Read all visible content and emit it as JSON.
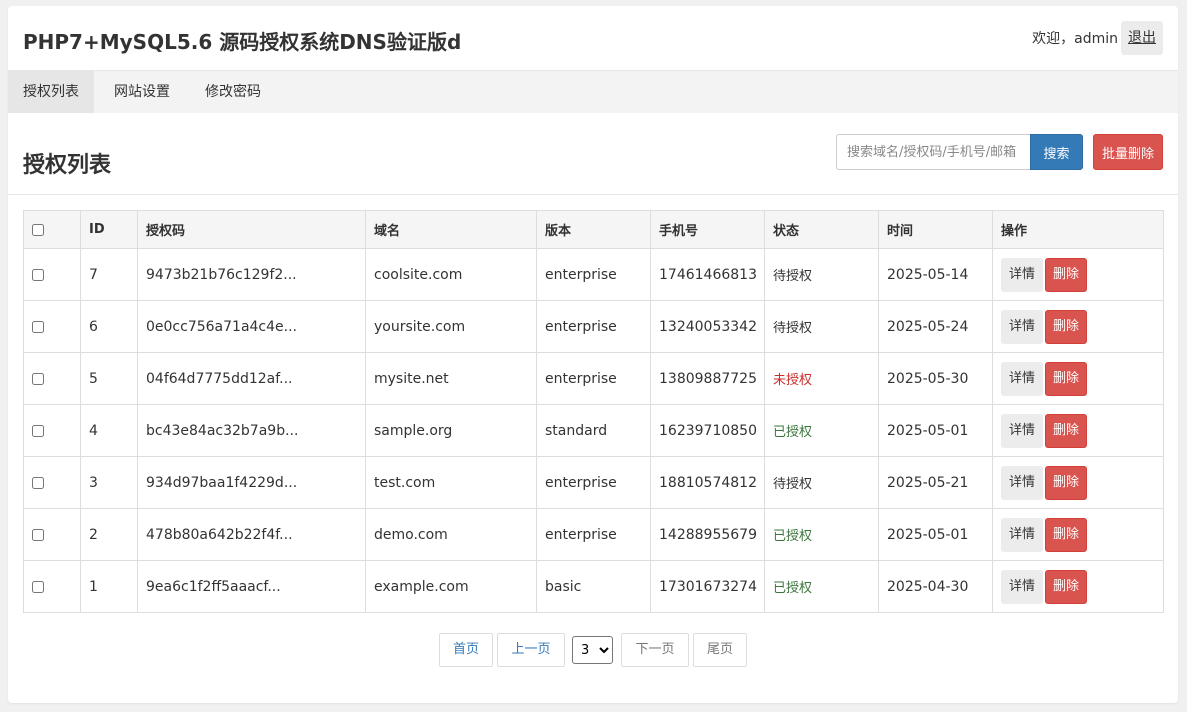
{
  "header": {
    "title": "PHP7+MySQL5.6 源码授权系统DNS验证版d",
    "welcome": "欢迎，admin",
    "logout_label": "退出"
  },
  "nav": {
    "tabs": [
      {
        "label": "授权列表",
        "active": true
      },
      {
        "label": "网站设置",
        "active": false
      },
      {
        "label": "修改密码",
        "active": false
      }
    ]
  },
  "panel": {
    "title": "授权列表",
    "search_placeholder": "搜索域名/授权码/手机号/邮箱",
    "search_label": "搜索",
    "bulk_delete_label": "批量删除"
  },
  "table": {
    "columns": [
      "ID",
      "授权码",
      "域名",
      "版本",
      "手机号",
      "状态",
      "时间",
      "操作"
    ],
    "rows": [
      {
        "id": "7",
        "code": "9473b21b76c129f2...",
        "domain": "coolsite.com",
        "version": "enterprise",
        "phone": "17461466813",
        "status": "待授权",
        "date": "2025-05-14"
      },
      {
        "id": "6",
        "code": "0e0cc756a71a4c4e...",
        "domain": "yoursite.com",
        "version": "enterprise",
        "phone": "13240053342",
        "status": "待授权",
        "date": "2025-05-24"
      },
      {
        "id": "5",
        "code": "04f64d7775dd12af...",
        "domain": "mysite.net",
        "version": "enterprise",
        "phone": "13809887725",
        "status": "未授权",
        "date": "2025-05-30"
      },
      {
        "id": "4",
        "code": "bc43e84ac32b7a9b...",
        "domain": "sample.org",
        "version": "standard",
        "phone": "16239710850",
        "status": "已授权",
        "date": "2025-05-01"
      },
      {
        "id": "3",
        "code": "934d97baa1f4229d...",
        "domain": "test.com",
        "version": "enterprise",
        "phone": "18810574812",
        "status": "待授权",
        "date": "2025-05-21"
      },
      {
        "id": "2",
        "code": "478b80a642b22f4f...",
        "domain": "demo.com",
        "version": "enterprise",
        "phone": "14288955679",
        "status": "已授权",
        "date": "2025-05-01"
      },
      {
        "id": "1",
        "code": "9ea6c1f2ff5aaacf...",
        "domain": "example.com",
        "version": "basic",
        "phone": "17301673274",
        "status": "已授权",
        "date": "2025-04-30"
      }
    ],
    "detail_label": "详情",
    "delete_label": "删除"
  },
  "status_colors": {
    "待授权": "#333333",
    "未授权": "#c9302c",
    "已授权": "#3c763d"
  },
  "pagination": {
    "first": "首页",
    "prev": "上一页",
    "current_page": "3",
    "next": "下一页",
    "last": "尾页"
  }
}
